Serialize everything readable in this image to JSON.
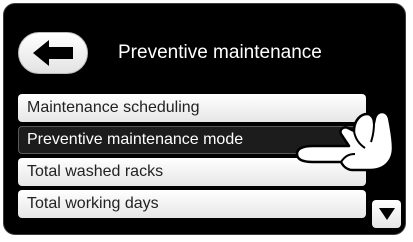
{
  "header": {
    "title": "Preventive maintenance",
    "back_icon": "arrow-left-icon"
  },
  "menu": {
    "items": [
      {
        "label": "Maintenance scheduling",
        "selected": false
      },
      {
        "label": "Preventive maintenance mode",
        "selected": true
      },
      {
        "label": "Total washed racks",
        "selected": false
      },
      {
        "label": "Total working days",
        "selected": false
      }
    ]
  },
  "scroll": {
    "down_icon": "triangle-down-icon"
  },
  "overlay": {
    "icon": "pointing-hand-icon"
  },
  "colors": {
    "screen_bg": "#000000",
    "item_bg": "#ffffff",
    "selected_bg": "#1c1c1c",
    "text_light": "#ffffff",
    "text_dark": "#222222"
  }
}
